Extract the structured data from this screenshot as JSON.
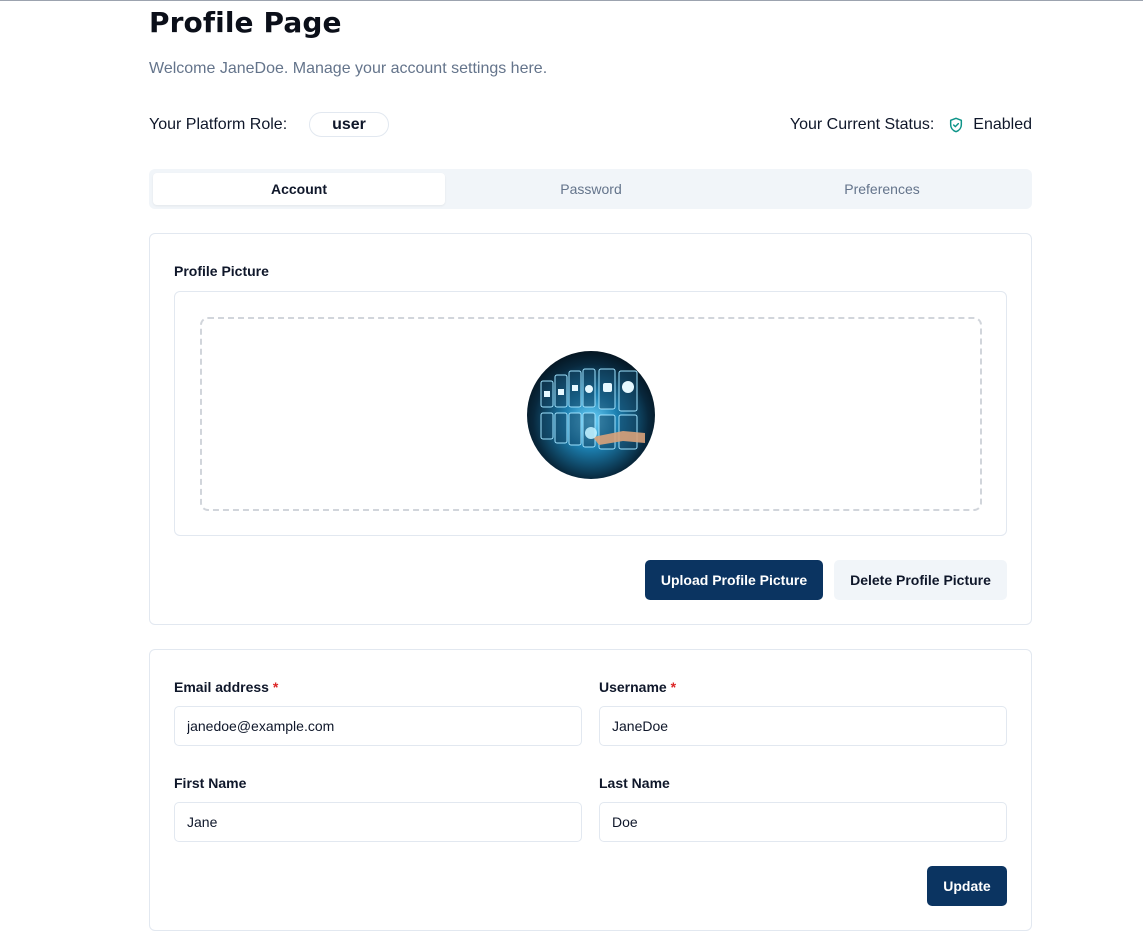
{
  "page": {
    "title": "Profile Page",
    "subtitle": "Welcome JaneDoe. Manage your account settings here."
  },
  "role": {
    "label": "Your Platform Role:",
    "value": "user"
  },
  "status": {
    "label": "Your Current Status:",
    "value": "Enabled",
    "icon": "shield-check-icon",
    "color": "#0d9488"
  },
  "tabs": [
    {
      "label": "Account",
      "active": true
    },
    {
      "label": "Password",
      "active": false
    },
    {
      "label": "Preferences",
      "active": false
    }
  ],
  "profile_picture": {
    "label": "Profile Picture",
    "upload_label": "Upload Profile Picture",
    "delete_label": "Delete Profile Picture"
  },
  "form": {
    "email": {
      "label": "Email address",
      "required_mark": "*",
      "value": "janedoe@example.com"
    },
    "username": {
      "label": "Username",
      "required_mark": "*",
      "value": "JaneDoe"
    },
    "first_name": {
      "label": "First Name",
      "value": "Jane"
    },
    "last_name": {
      "label": "Last Name",
      "value": "Doe"
    },
    "update_label": "Update"
  },
  "colors": {
    "primary": "#0b3461",
    "secondary": "#f1f5f9",
    "required": "#dc2626",
    "muted_text": "#64748b"
  }
}
